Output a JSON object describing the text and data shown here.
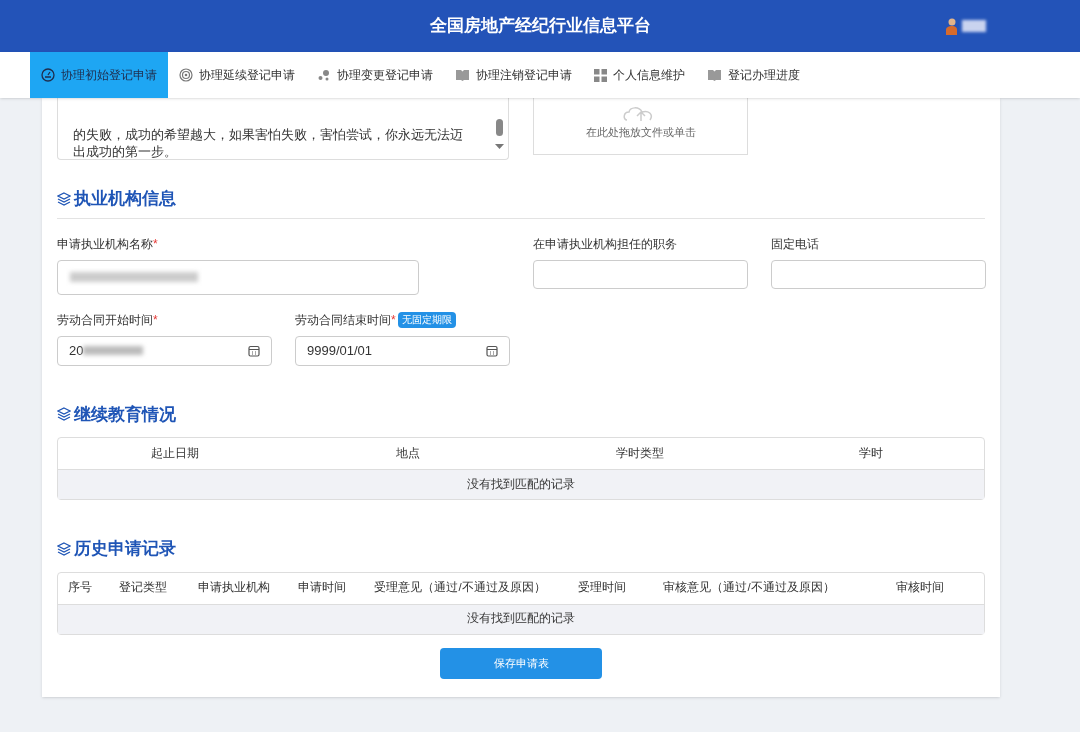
{
  "header": {
    "title": "全国房地产经纪行业信息平台"
  },
  "nav": [
    {
      "label": "协理初始登记申请",
      "selected": true
    },
    {
      "label": "协理延续登记申请",
      "selected": false
    },
    {
      "label": "协理变更登记申请",
      "selected": false
    },
    {
      "label": "协理注销登记申请",
      "selected": false
    },
    {
      "label": "个人信息维护",
      "selected": false
    },
    {
      "label": "登记办理进度",
      "selected": false
    }
  ],
  "statement": {
    "lines": [
      "的失败，成功的希望越大，如果害怕失败，害怕尝试，你永远无法迈",
      "出成功的第一步。"
    ]
  },
  "upload": {
    "hint": "在此处拖放文件或单击"
  },
  "org_section": {
    "title": "执业机构信息",
    "fields": [
      {
        "label": "申请执业机构名称",
        "required_mark": "*",
        "blurred": true
      },
      {
        "label": "在申请执业机构担任的职务",
        "blurred": false
      },
      {
        "label": "固定电话",
        "blurred": false
      }
    ],
    "dates": [
      {
        "label": "劳动合同开始时间",
        "required_mark": "*",
        "value": "20",
        "blurred": true
      },
      {
        "label": "劳动合同结束时间",
        "required_mark": "*",
        "value": "9999/01/01",
        "blurred": false,
        "badge": "无固定期限"
      }
    ]
  },
  "education": {
    "title": "继续教育情况",
    "columns": [
      "起止日期",
      "地点",
      "学时类型",
      "学时"
    ],
    "empty": "没有找到匹配的记录"
  },
  "history": {
    "title": "历史申请记录",
    "columns": [
      "序号",
      "登记类型",
      "申请执业机构",
      "申请时间",
      "受理意见（通过/不通过及原因）",
      "受理时间",
      "审核意见（通过/不通过及原因）",
      "审核时间"
    ],
    "empty": "没有找到匹配的记录"
  },
  "save_button": "保存申请表"
}
